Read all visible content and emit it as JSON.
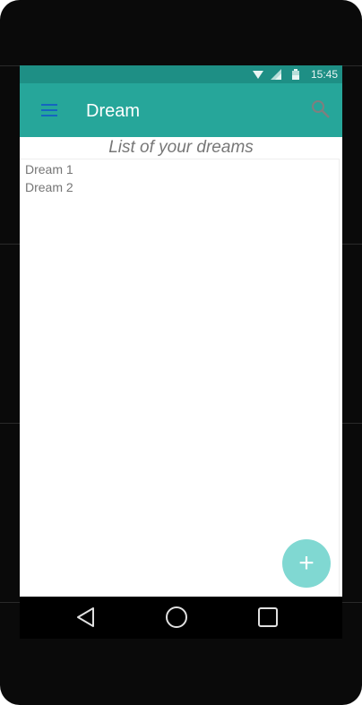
{
  "status_bar": {
    "time": "15:45",
    "icons": [
      "wifi-icon",
      "cell-signal-icon",
      "battery-icon"
    ]
  },
  "app_bar": {
    "title": "Dream",
    "menu_icon": "hamburger-menu-icon",
    "search_icon": "search-icon"
  },
  "main": {
    "subtitle": "List of your dreams",
    "dreams": [
      "Dream 1",
      "Dream 2"
    ]
  },
  "fab": {
    "label": "+"
  },
  "nav_bar": {
    "icons": [
      "back-icon",
      "home-icon",
      "recents-icon"
    ]
  },
  "colors": {
    "primary": "#26a69a",
    "primary_dark": "#1e8f85",
    "fab": "#80d8d2",
    "device_frame": "#0a0a0a"
  }
}
